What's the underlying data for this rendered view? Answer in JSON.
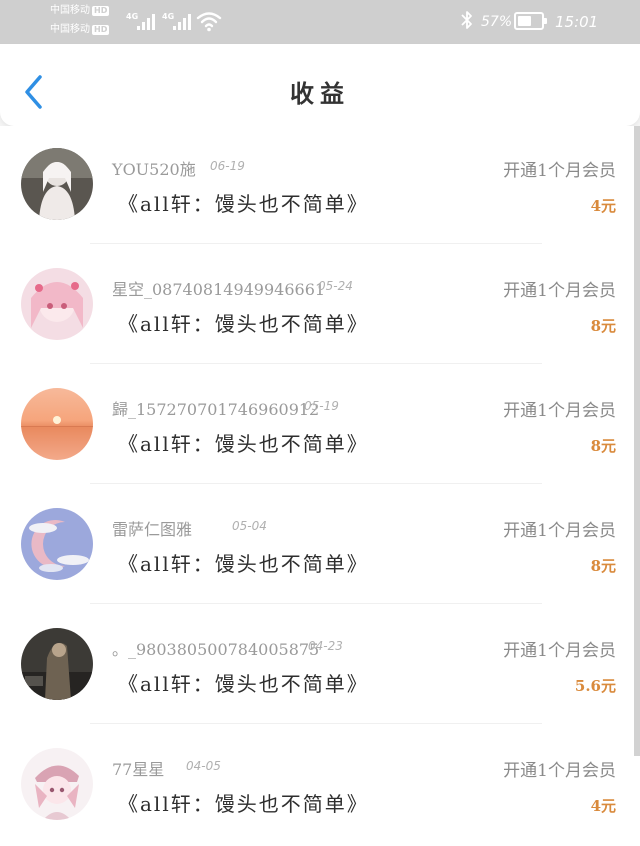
{
  "status_bar": {
    "carrier1": "中国移动",
    "carrier2": "中国移动",
    "hd": "HD",
    "network_label": "4G",
    "battery_percent": "57%",
    "battery_level": 0.57,
    "time": "15:01",
    "icons": [
      "bluetooth-icon",
      "wifi-icon",
      "signal-icon",
      "battery-icon"
    ]
  },
  "header": {
    "title": "收益",
    "back_icon": "chevron-left-icon",
    "accent_color": "#2f8fe4"
  },
  "colors": {
    "amount": "#d98a3c"
  },
  "list": {
    "items": [
      {
        "username": "YOU520施",
        "date": "06-19",
        "title": "《all轩：馒头也不简单》",
        "description": "开通1个月会员",
        "amount": "4元"
      },
      {
        "username": "星空_08740814949946661",
        "date": "05-24",
        "title": "《all轩：馒头也不简单》",
        "description": "开通1个月会员",
        "amount": "8元"
      },
      {
        "username": "歸_157270701746960912",
        "date": "05-19",
        "title": "《all轩：馒头也不简单》",
        "description": "开通1个月会员",
        "amount": "8元"
      },
      {
        "username": "雷萨仁图雅",
        "date": "05-04",
        "title": "《all轩：馒头也不简单》",
        "description": "开通1个月会员",
        "amount": "8元"
      },
      {
        "username": "。_980380500784005875",
        "date": "04-23",
        "title": "《all轩：馒头也不简单》",
        "description": "开通1个月会员",
        "amount": "5.6元"
      },
      {
        "username": "77星星",
        "date": "04-05",
        "title": "《all轩：馒头也不简单》",
        "description": "开通1个月会员",
        "amount": "4元"
      }
    ]
  }
}
